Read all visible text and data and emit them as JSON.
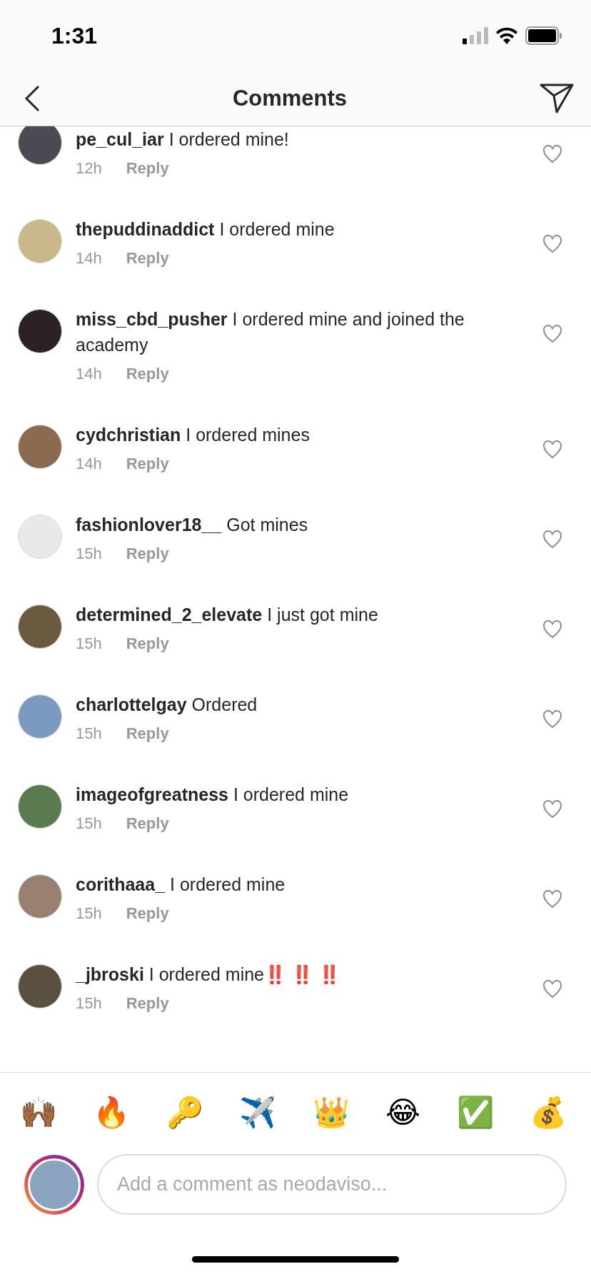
{
  "status_bar": {
    "time": "1:31"
  },
  "nav": {
    "title": "Comments"
  },
  "comments": [
    {
      "username": "pe_cul_iar",
      "text": "I ordered mine!",
      "time": "12h",
      "reply": "Reply"
    },
    {
      "username": "thepuddinaddict",
      "text": "I ordered mine",
      "time": "14h",
      "reply": "Reply"
    },
    {
      "username": "miss_cbd_pusher",
      "text": "I ordered mine and joined the academy",
      "time": "14h",
      "reply": "Reply"
    },
    {
      "username": "cydchristian",
      "text": "I ordered mines",
      "time": "14h",
      "reply": "Reply"
    },
    {
      "username": "fashionlover18__",
      "text": "Got mines",
      "time": "15h",
      "reply": "Reply"
    },
    {
      "username": "determined_2_elevate",
      "text": "I just got mine",
      "time": "15h",
      "reply": "Reply"
    },
    {
      "username": "charlottelgay",
      "text": "Ordered",
      "time": "15h",
      "reply": "Reply"
    },
    {
      "username": "imageofgreatness",
      "text": "I ordered mine",
      "time": "15h",
      "reply": "Reply"
    },
    {
      "username": "corithaaa_",
      "text": "I ordered mine",
      "time": "15h",
      "reply": "Reply"
    },
    {
      "username": "_jbroski",
      "text": "I ordered mine‼️ ‼️ ‼️",
      "time": "15h",
      "reply": "Reply"
    }
  ],
  "emoji_bar": [
    "🙌🏾",
    "🔥",
    "🔑",
    "✈️",
    "👑",
    "😂",
    "✅",
    "💰"
  ],
  "composer": {
    "placeholder": "Add a comment as neodaviso..."
  }
}
